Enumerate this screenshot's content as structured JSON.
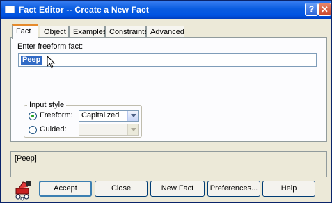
{
  "window": {
    "title": "Fact Editor -- Create a New Fact",
    "help_glyph": "?",
    "close_glyph": "✕"
  },
  "tabs": [
    {
      "label": "Fact",
      "active": true
    },
    {
      "label": "Object",
      "active": false
    },
    {
      "label": "Examples",
      "active": false
    },
    {
      "label": "Constraints",
      "active": false
    },
    {
      "label": "Advanced",
      "active": false
    }
  ],
  "fact_tab": {
    "input_label": "Enter freeform fact:",
    "input_value": "Peep",
    "input_style": {
      "legend": "Input style",
      "freeform_label": "Freeform:",
      "freeform_checked": true,
      "freeform_select_value": "Capitalized",
      "guided_label": "Guided:",
      "guided_checked": false,
      "guided_select_value": ""
    }
  },
  "output": {
    "text": "[Peep]"
  },
  "buttons": {
    "accept": "Accept",
    "close": "Close",
    "new_fact": "New Fact",
    "preferences": "Preferences...",
    "help": "Help"
  },
  "colors": {
    "titlebar": "#0054e3",
    "window_bg": "#ece9d8",
    "selection": "#316ac5",
    "active_tab_accent": "#e68b2c"
  },
  "icons": {
    "app_logo": "robot-arm-icon",
    "cursor": "mouse-pointer-icon"
  }
}
